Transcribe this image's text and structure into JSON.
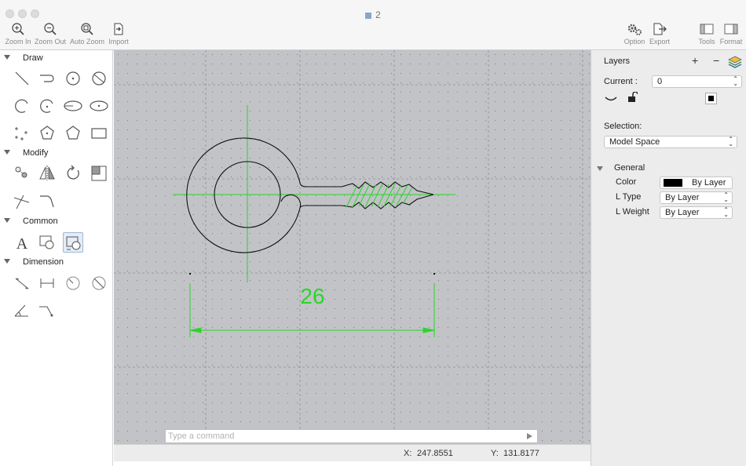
{
  "window": {
    "title": "2"
  },
  "toolbar": {
    "zoom_in": "Zoom In",
    "zoom_out": "Zoom Out",
    "auto_zoom": "Auto Zoom",
    "import": "Import",
    "option": "Option",
    "export": "Export",
    "tools": "Tools",
    "format": "Format"
  },
  "left_panel": {
    "sections": {
      "draw": "Draw",
      "modify": "Modify",
      "common": "Common",
      "dimension": "Dimension"
    }
  },
  "canvas": {
    "dimension_value": "26",
    "command_placeholder": "Type a command"
  },
  "status": {
    "x_label": "X:",
    "x_value": "247.8551",
    "y_label": "Y:",
    "y_value": "131.8177"
  },
  "right_panel": {
    "layers_title": "Layers",
    "add_symbol": "+",
    "remove_symbol": "−",
    "current_label": "Current :",
    "current_value": "0",
    "selection_label": "Selection:",
    "selection_value": "Model Space",
    "general_label": "General",
    "color_label": "Color",
    "color_value": "By Layer",
    "ltype_label": "L Type",
    "ltype_value": "By Layer",
    "lweight_label": "L Weight",
    "lweight_value": "By Layer"
  },
  "colors": {
    "canvas_bg": "#c1c3c6",
    "drawing_green": "#2ad62a",
    "layer_color_swatch": "#000000"
  }
}
